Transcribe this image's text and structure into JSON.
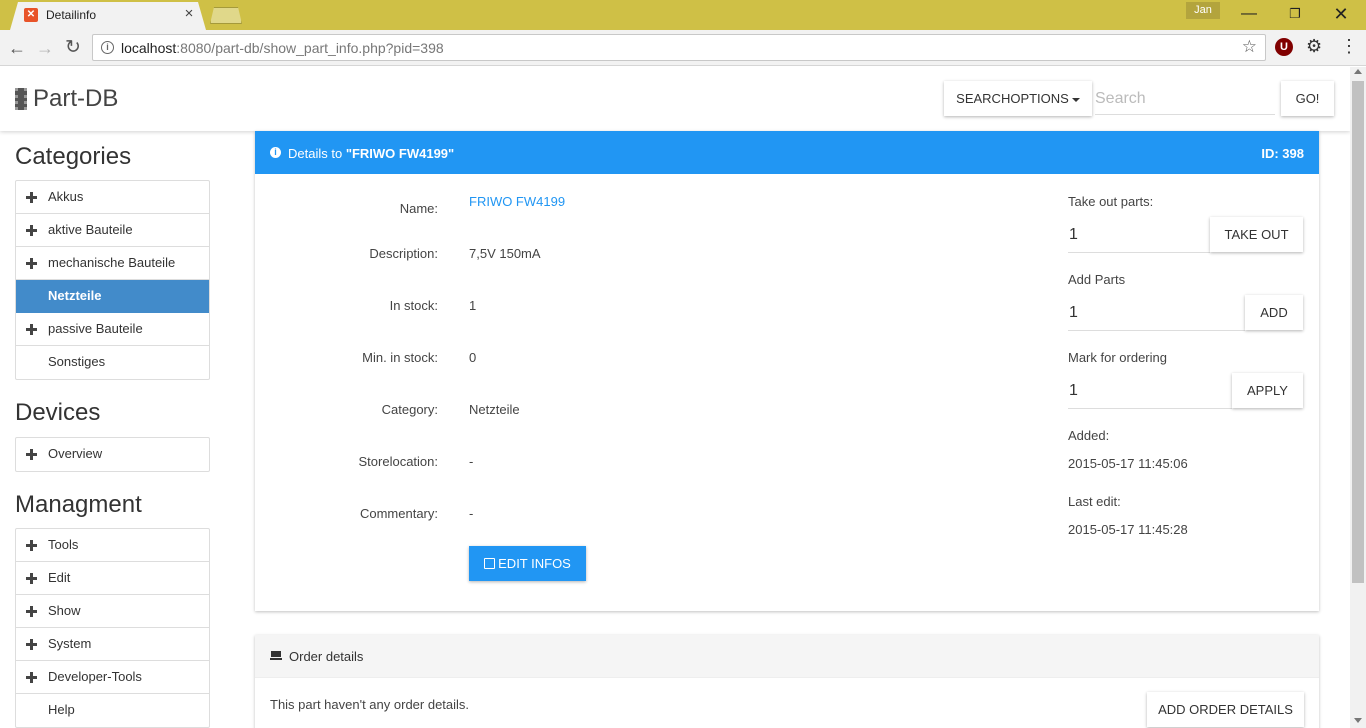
{
  "browser": {
    "tab_title": "Detailinfo",
    "tab_close": "×",
    "user": "Jan",
    "url_host": "localhost",
    "url_rest": ":8080/part-db/show_part_info.php?pid=398",
    "window_min": "—",
    "window_max": "❐",
    "window_close": "✕",
    "back": "←",
    "forward": "→",
    "reload": "↻",
    "star": "☆",
    "ublock": "U",
    "gear": "⚙",
    "menu": "⋮"
  },
  "navbar": {
    "brand": "Part-DB",
    "searchoptions_label": "SEARCHOPTIONS",
    "search_placeholder": "Search",
    "go_label": "GO!"
  },
  "sidebar": {
    "categories_heading": "Categories",
    "categories": [
      {
        "label": "Akkus",
        "expandable": true,
        "active": false
      },
      {
        "label": "aktive Bauteile",
        "expandable": true,
        "active": false
      },
      {
        "label": "mechanische Bauteile",
        "expandable": true,
        "active": false
      },
      {
        "label": "Netzteile",
        "expandable": false,
        "active": true
      },
      {
        "label": "passive Bauteile",
        "expandable": true,
        "active": false
      },
      {
        "label": "Sonstiges",
        "expandable": false,
        "active": false
      }
    ],
    "devices_heading": "Devices",
    "devices": [
      {
        "label": "Overview",
        "expandable": true
      }
    ],
    "management_heading": "Managment",
    "management": [
      {
        "label": "Tools",
        "expandable": true
      },
      {
        "label": "Edit",
        "expandable": true
      },
      {
        "label": "Show",
        "expandable": true
      },
      {
        "label": "System",
        "expandable": true
      },
      {
        "label": "Developer-Tools",
        "expandable": true
      },
      {
        "label": "Help",
        "expandable": false
      }
    ]
  },
  "details": {
    "title_prefix": "Details to ",
    "title_name": "\"FRIWO FW4199\"",
    "id_label": "ID: 398",
    "fields": {
      "name_label": "Name:",
      "name_value": "FRIWO FW4199",
      "description_label": "Description:",
      "description_value": "7,5V 150mA",
      "instock_label": "In stock:",
      "instock_value": "1",
      "mininstock_label": "Min. in stock:",
      "mininstock_value": "0",
      "category_label": "Category:",
      "category_value": "Netzteile",
      "storelocation_label": "Storelocation:",
      "storelocation_value": "-",
      "commentary_label": "Commentary:",
      "commentary_value": "-"
    },
    "edit_label": "EDIT INFOS",
    "takeout_label": "Take out parts:",
    "takeout_value": "1",
    "takeout_button": "TAKE OUT",
    "add_label": "Add Parts",
    "add_value": "1",
    "add_button": "ADD",
    "order_label": "Mark for ordering",
    "order_value": "1",
    "apply_button": "APPLY",
    "added_label": "Added:",
    "added_value": "2015-05-17 11:45:06",
    "lastedit_label": "Last edit:",
    "lastedit_value": "2015-05-17 11:45:28"
  },
  "order": {
    "title": "Order details",
    "text": "This part haven't any order details.",
    "add_button": "ADD ORDER DETAILS"
  },
  "colors": {
    "primary": "#2196f3",
    "active_item": "#428bca",
    "titlebar": "#cfc046"
  }
}
